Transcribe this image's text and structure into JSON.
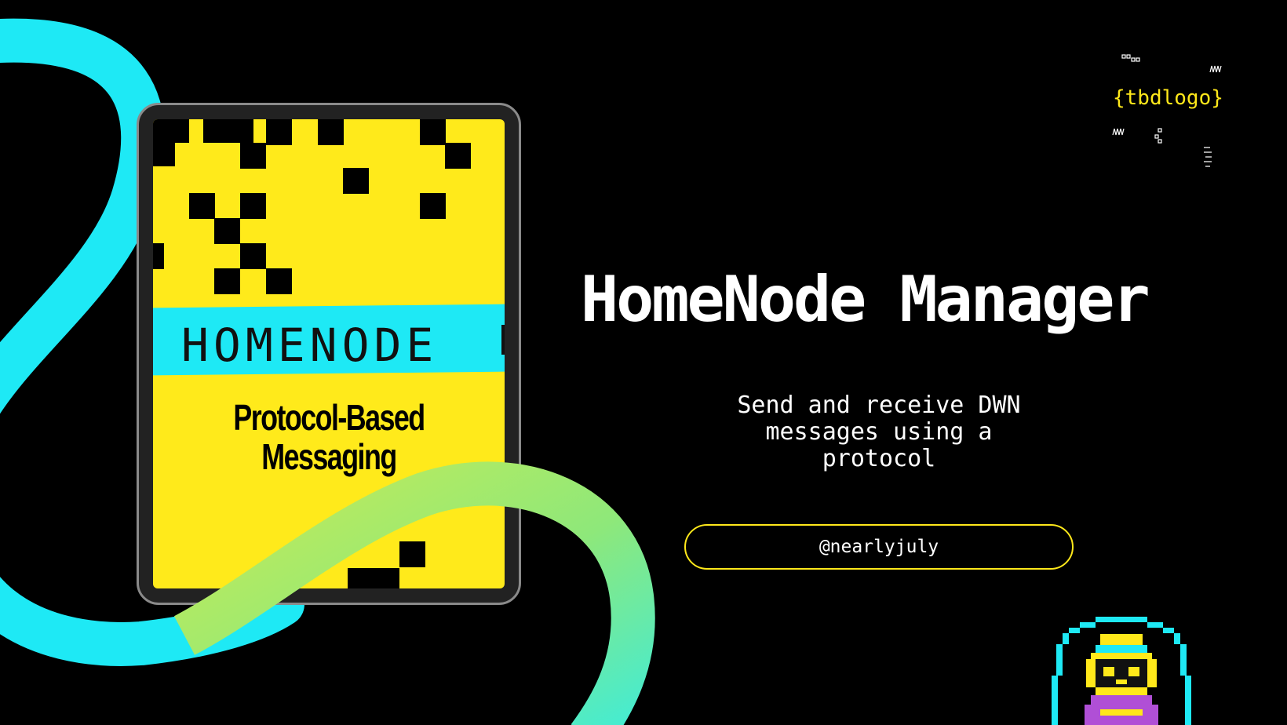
{
  "tablet": {
    "band_label": "HOMENODE",
    "subtitle_line1": "Protocol-Based",
    "subtitle_line2": "Messaging"
  },
  "main": {
    "title": "HomeNode Manager",
    "subtitle_line1": "Send and receive DWN",
    "subtitle_line2": "messages using a",
    "subtitle_line3": "protocol",
    "handle": "@nearlyjuly"
  },
  "logo": {
    "text": "{tbdlogo}"
  },
  "colors": {
    "background": "#000000",
    "cyan": "#1ee9f5",
    "yellow": "#ffea1b",
    "green_start": "#c8ec55",
    "green_end": "#40ecd8",
    "white": "#ffffff"
  },
  "icons": [
    "tbd-logo-decoration",
    "pixel-astronaut-avatar"
  ]
}
